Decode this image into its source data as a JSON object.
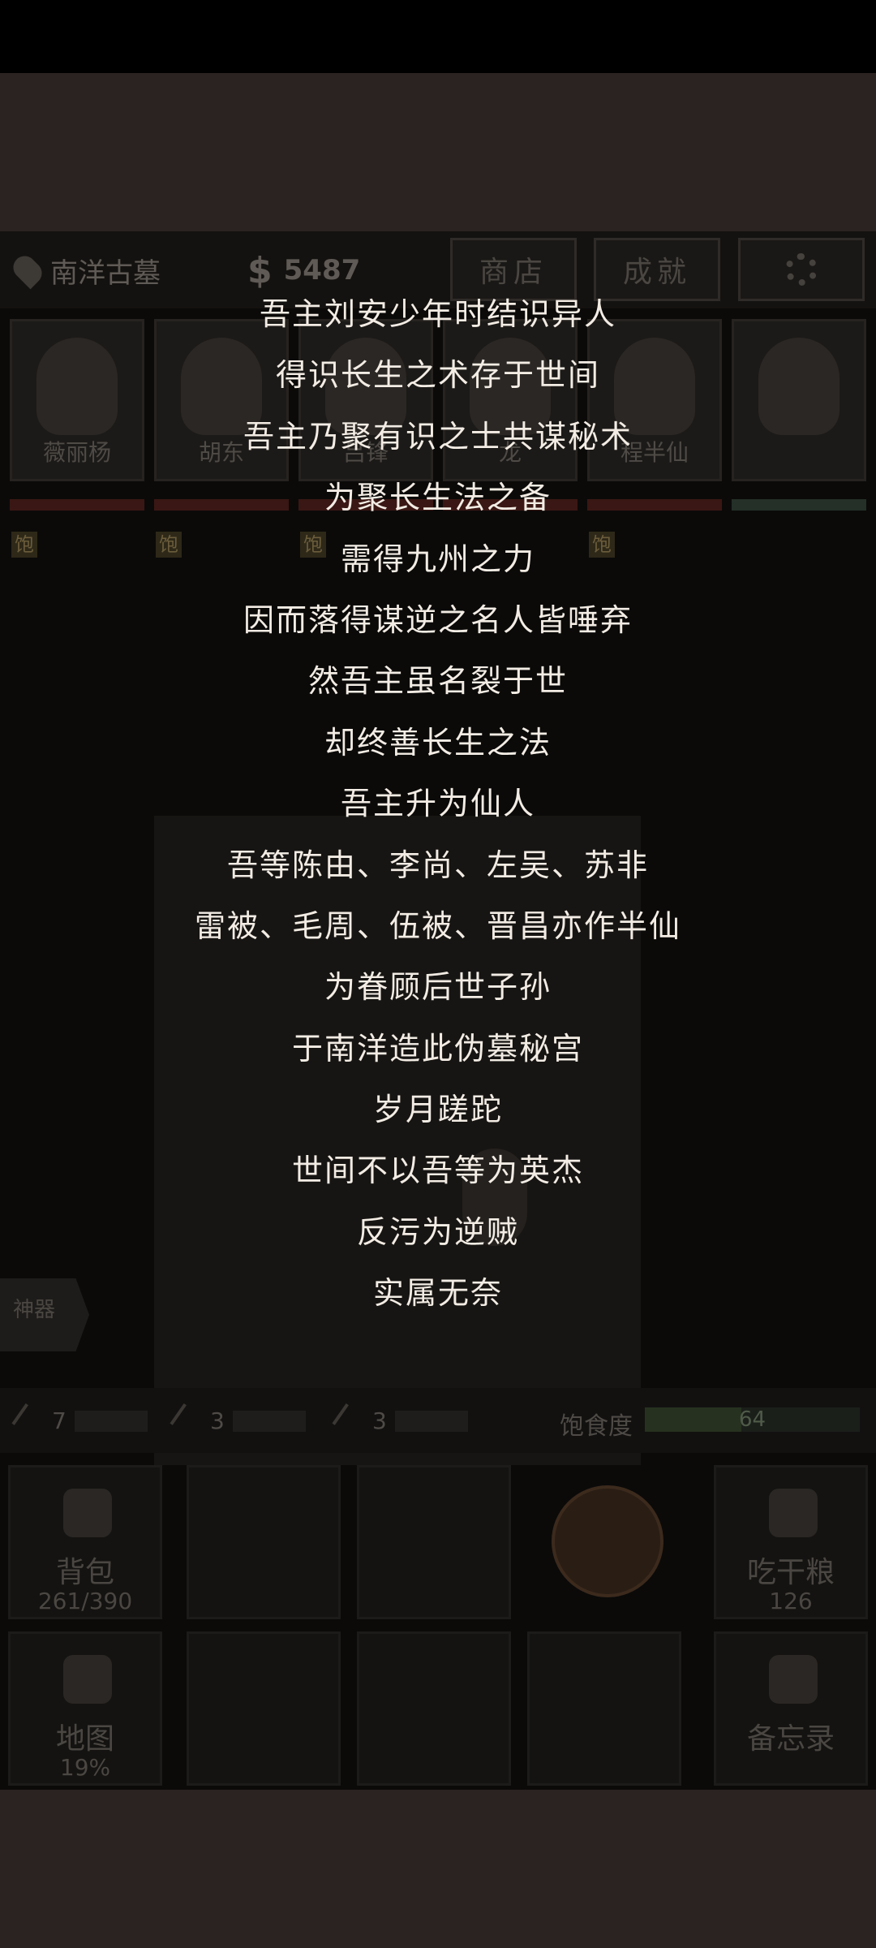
{
  "hud": {
    "location": "南洋古墓",
    "money_symbol": "$",
    "money": "5487",
    "shop_label": "商店",
    "achievements_label": "成就"
  },
  "party": [
    {
      "name": "薇丽杨",
      "status": "饱"
    },
    {
      "name": "胡东",
      "status": "饱"
    },
    {
      "name": "吕锋",
      "status": "饱"
    },
    {
      "name": "龙",
      "status": ""
    },
    {
      "name": "程半仙",
      "status": "饱"
    },
    {
      "name": "",
      "status": ""
    }
  ],
  "artifact_label": "神器",
  "tools": [
    {
      "icon": "pickaxe-icon",
      "count": "7"
    },
    {
      "icon": "rope-icon",
      "count": "3"
    },
    {
      "icon": "shovel-icon",
      "count": "3"
    }
  ],
  "hunger": {
    "label": "饱食度",
    "value": "64",
    "fraction": 0.45
  },
  "actions": {
    "backpack_label": "背包",
    "backpack_capacity": "261/390",
    "eat_label": "吃干粮",
    "eat_count": "126",
    "map_label": "地图",
    "map_progress": "19%",
    "memo_label": "备忘录"
  },
  "story_lines": [
    "吾主刘安少年时结识异人",
    "得识长生之术存于世间",
    "吾主乃聚有识之士共谋秘术",
    "为聚长生法之备",
    "需得九州之力",
    "因而落得谋逆之名人皆唾弃",
    "然吾主虽名裂于世",
    "却终善长生之法",
    "吾主升为仙人",
    "吾等陈由、李尚、左吴、苏非",
    "雷被、毛周、伍被、晋昌亦作半仙",
    "为眷顾后世子孙",
    "于南洋造此伪墓秘宫",
    "岁月蹉跎",
    "世间不以吾等为英杰",
    "反污为逆贼",
    "实属无奈"
  ]
}
